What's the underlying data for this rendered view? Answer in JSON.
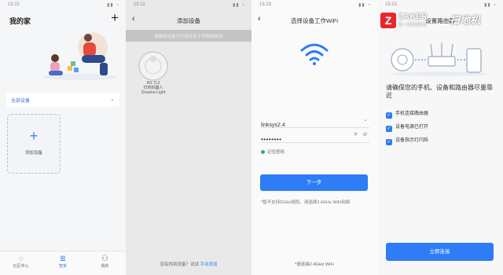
{
  "p1": {
    "status_time": "15:22",
    "title": "我的家",
    "plus": "+",
    "selector_label": "全部设备",
    "add_plus": "+",
    "add_label": "添加设备",
    "tabs": [
      {
        "label": "社区中心",
        "icon": "chat-icon"
      },
      {
        "label": "智家",
        "icon": "list-icon"
      },
      {
        "label": "我的",
        "icon": "person-icon"
      }
    ]
  },
  "p2": {
    "status_time": "15:22",
    "title": "添加设备",
    "banner": "请确保设备已开机并处于待配网状态",
    "device_lines": [
      "RS 7L3",
      "扫地机器人",
      "Dreame-Light"
    ],
    "footer_text": "没有找到设备？试试",
    "footer_link": "手动添加"
  },
  "p3": {
    "status_time": "15:23",
    "title": "选择设备工作WiFi",
    "ssid": "linksys2.4",
    "password": "••••••••",
    "remember": "记住密码",
    "next_button": "下一步",
    "note": "*暂不支持5GHz频段，请选择2.4GHz WiFi网络",
    "footer": "*请连接2.4GHz WiFi"
  },
  "p4": {
    "status_time": "15:23",
    "title": "设置路由器",
    "brand": "Z",
    "brand_word": "ZAKER",
    "brand_sub": "新一代新闻资讯",
    "brand_tag": "扫地机",
    "heading": "请确保您的手机、设备和路由器尽量靠近",
    "checks": [
      "手机连接路由器",
      "设备电源已打开",
      "设备指示灯闪烁"
    ],
    "button": "立即连接"
  },
  "colors": {
    "accent": "#2e7cf6",
    "success": "#2db26e",
    "brand_red": "#e8262d"
  }
}
